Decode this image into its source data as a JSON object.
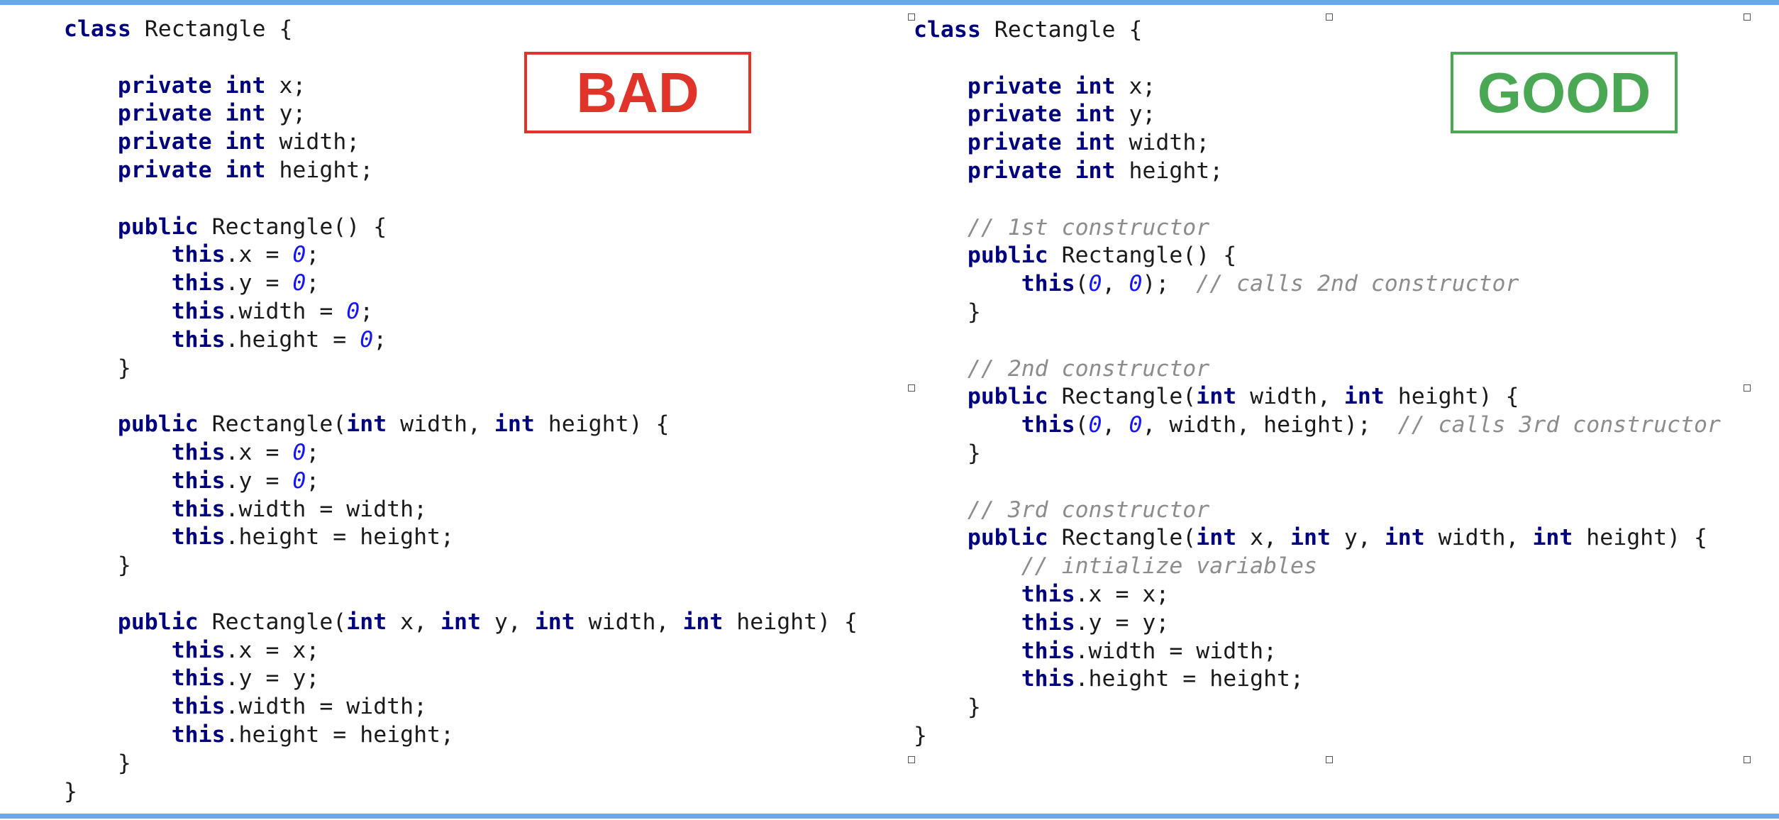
{
  "colors": {
    "bar": "#6aa6ec",
    "keyword": "#00007f",
    "number": "#1414ff",
    "comment": "#8c8c8c",
    "text": "#1a1a1a",
    "bad": "#e0332a",
    "good": "#4aa855"
  },
  "left_panel": {
    "label": "BAD",
    "label_color": "#e0332a",
    "lines": [
      [
        {
          "t": "kw",
          "v": "class"
        },
        {
          "t": "plain",
          "v": " Rectangle {"
        }
      ],
      [],
      [
        {
          "t": "plain",
          "v": "    "
        },
        {
          "t": "kw",
          "v": "private"
        },
        {
          "t": "plain",
          "v": " "
        },
        {
          "t": "kw",
          "v": "int"
        },
        {
          "t": "plain",
          "v": " x;"
        }
      ],
      [
        {
          "t": "plain",
          "v": "    "
        },
        {
          "t": "kw",
          "v": "private"
        },
        {
          "t": "plain",
          "v": " "
        },
        {
          "t": "kw",
          "v": "int"
        },
        {
          "t": "plain",
          "v": " y;"
        }
      ],
      [
        {
          "t": "plain",
          "v": "    "
        },
        {
          "t": "kw",
          "v": "private"
        },
        {
          "t": "plain",
          "v": " "
        },
        {
          "t": "kw",
          "v": "int"
        },
        {
          "t": "plain",
          "v": " width;"
        }
      ],
      [
        {
          "t": "plain",
          "v": "    "
        },
        {
          "t": "kw",
          "v": "private"
        },
        {
          "t": "plain",
          "v": " "
        },
        {
          "t": "kw",
          "v": "int"
        },
        {
          "t": "plain",
          "v": " height;"
        }
      ],
      [],
      [
        {
          "t": "plain",
          "v": "    "
        },
        {
          "t": "kw",
          "v": "public"
        },
        {
          "t": "plain",
          "v": " Rectangle() {"
        }
      ],
      [
        {
          "t": "plain",
          "v": "        "
        },
        {
          "t": "kw",
          "v": "this"
        },
        {
          "t": "plain",
          "v": ".x = "
        },
        {
          "t": "num",
          "v": "0"
        },
        {
          "t": "plain",
          "v": ";"
        }
      ],
      [
        {
          "t": "plain",
          "v": "        "
        },
        {
          "t": "kw",
          "v": "this"
        },
        {
          "t": "plain",
          "v": ".y = "
        },
        {
          "t": "num",
          "v": "0"
        },
        {
          "t": "plain",
          "v": ";"
        }
      ],
      [
        {
          "t": "plain",
          "v": "        "
        },
        {
          "t": "kw",
          "v": "this"
        },
        {
          "t": "plain",
          "v": ".width = "
        },
        {
          "t": "num",
          "v": "0"
        },
        {
          "t": "plain",
          "v": ";"
        }
      ],
      [
        {
          "t": "plain",
          "v": "        "
        },
        {
          "t": "kw",
          "v": "this"
        },
        {
          "t": "plain",
          "v": ".height = "
        },
        {
          "t": "num",
          "v": "0"
        },
        {
          "t": "plain",
          "v": ";"
        }
      ],
      [
        {
          "t": "plain",
          "v": "    }"
        }
      ],
      [],
      [
        {
          "t": "plain",
          "v": "    "
        },
        {
          "t": "kw",
          "v": "public"
        },
        {
          "t": "plain",
          "v": " Rectangle("
        },
        {
          "t": "kw",
          "v": "int"
        },
        {
          "t": "plain",
          "v": " width, "
        },
        {
          "t": "kw",
          "v": "int"
        },
        {
          "t": "plain",
          "v": " height) {"
        }
      ],
      [
        {
          "t": "plain",
          "v": "        "
        },
        {
          "t": "kw",
          "v": "this"
        },
        {
          "t": "plain",
          "v": ".x = "
        },
        {
          "t": "num",
          "v": "0"
        },
        {
          "t": "plain",
          "v": ";"
        }
      ],
      [
        {
          "t": "plain",
          "v": "        "
        },
        {
          "t": "kw",
          "v": "this"
        },
        {
          "t": "plain",
          "v": ".y = "
        },
        {
          "t": "num",
          "v": "0"
        },
        {
          "t": "plain",
          "v": ";"
        }
      ],
      [
        {
          "t": "plain",
          "v": "        "
        },
        {
          "t": "kw",
          "v": "this"
        },
        {
          "t": "plain",
          "v": ".width = width;"
        }
      ],
      [
        {
          "t": "plain",
          "v": "        "
        },
        {
          "t": "kw",
          "v": "this"
        },
        {
          "t": "plain",
          "v": ".height = height;"
        }
      ],
      [
        {
          "t": "plain",
          "v": "    }"
        }
      ],
      [],
      [
        {
          "t": "plain",
          "v": "    "
        },
        {
          "t": "kw",
          "v": "public"
        },
        {
          "t": "plain",
          "v": " Rectangle("
        },
        {
          "t": "kw",
          "v": "int"
        },
        {
          "t": "plain",
          "v": " x, "
        },
        {
          "t": "kw",
          "v": "int"
        },
        {
          "t": "plain",
          "v": " y, "
        },
        {
          "t": "kw",
          "v": "int"
        },
        {
          "t": "plain",
          "v": " width, "
        },
        {
          "t": "kw",
          "v": "int"
        },
        {
          "t": "plain",
          "v": " height) {"
        }
      ],
      [
        {
          "t": "plain",
          "v": "        "
        },
        {
          "t": "kw",
          "v": "this"
        },
        {
          "t": "plain",
          "v": ".x = x;"
        }
      ],
      [
        {
          "t": "plain",
          "v": "        "
        },
        {
          "t": "kw",
          "v": "this"
        },
        {
          "t": "plain",
          "v": ".y = y;"
        }
      ],
      [
        {
          "t": "plain",
          "v": "        "
        },
        {
          "t": "kw",
          "v": "this"
        },
        {
          "t": "plain",
          "v": ".width = width;"
        }
      ],
      [
        {
          "t": "plain",
          "v": "        "
        },
        {
          "t": "kw",
          "v": "this"
        },
        {
          "t": "plain",
          "v": ".height = height;"
        }
      ],
      [
        {
          "t": "plain",
          "v": "    }"
        }
      ],
      [
        {
          "t": "plain",
          "v": "}"
        }
      ]
    ]
  },
  "right_panel": {
    "label": "GOOD",
    "label_color": "#4aa855",
    "lines": [
      [
        {
          "t": "kw",
          "v": "class"
        },
        {
          "t": "plain",
          "v": " Rectangle {"
        }
      ],
      [],
      [
        {
          "t": "plain",
          "v": "    "
        },
        {
          "t": "kw",
          "v": "private"
        },
        {
          "t": "plain",
          "v": " "
        },
        {
          "t": "kw",
          "v": "int"
        },
        {
          "t": "plain",
          "v": " x;"
        }
      ],
      [
        {
          "t": "plain",
          "v": "    "
        },
        {
          "t": "kw",
          "v": "private"
        },
        {
          "t": "plain",
          "v": " "
        },
        {
          "t": "kw",
          "v": "int"
        },
        {
          "t": "plain",
          "v": " y;"
        }
      ],
      [
        {
          "t": "plain",
          "v": "    "
        },
        {
          "t": "kw",
          "v": "private"
        },
        {
          "t": "plain",
          "v": " "
        },
        {
          "t": "kw",
          "v": "int"
        },
        {
          "t": "plain",
          "v": " width;"
        }
      ],
      [
        {
          "t": "plain",
          "v": "    "
        },
        {
          "t": "kw",
          "v": "private"
        },
        {
          "t": "plain",
          "v": " "
        },
        {
          "t": "kw",
          "v": "int"
        },
        {
          "t": "plain",
          "v": " height;"
        }
      ],
      [],
      [
        {
          "t": "plain",
          "v": "    "
        },
        {
          "t": "com",
          "v": "// 1st constructor"
        }
      ],
      [
        {
          "t": "plain",
          "v": "    "
        },
        {
          "t": "kw",
          "v": "public"
        },
        {
          "t": "plain",
          "v": " Rectangle() {"
        }
      ],
      [
        {
          "t": "plain",
          "v": "        "
        },
        {
          "t": "kw",
          "v": "this"
        },
        {
          "t": "plain",
          "v": "("
        },
        {
          "t": "num",
          "v": "0"
        },
        {
          "t": "plain",
          "v": ", "
        },
        {
          "t": "num",
          "v": "0"
        },
        {
          "t": "plain",
          "v": ");  "
        },
        {
          "t": "com",
          "v": "// calls 2nd constructor"
        }
      ],
      [
        {
          "t": "plain",
          "v": "    }"
        }
      ],
      [],
      [
        {
          "t": "plain",
          "v": "    "
        },
        {
          "t": "com",
          "v": "// 2nd constructor"
        }
      ],
      [
        {
          "t": "plain",
          "v": "    "
        },
        {
          "t": "kw",
          "v": "public"
        },
        {
          "t": "plain",
          "v": " Rectangle("
        },
        {
          "t": "kw",
          "v": "int"
        },
        {
          "t": "plain",
          "v": " width, "
        },
        {
          "t": "kw",
          "v": "int"
        },
        {
          "t": "plain",
          "v": " height) {"
        }
      ],
      [
        {
          "t": "plain",
          "v": "        "
        },
        {
          "t": "kw",
          "v": "this"
        },
        {
          "t": "plain",
          "v": "("
        },
        {
          "t": "num",
          "v": "0"
        },
        {
          "t": "plain",
          "v": ", "
        },
        {
          "t": "num",
          "v": "0"
        },
        {
          "t": "plain",
          "v": ", width, height);  "
        },
        {
          "t": "com",
          "v": "// calls 3rd constructor"
        }
      ],
      [
        {
          "t": "plain",
          "v": "    }"
        }
      ],
      [],
      [
        {
          "t": "plain",
          "v": "    "
        },
        {
          "t": "com",
          "v": "// 3rd constructor"
        }
      ],
      [
        {
          "t": "plain",
          "v": "    "
        },
        {
          "t": "kw",
          "v": "public"
        },
        {
          "t": "plain",
          "v": " Rectangle("
        },
        {
          "t": "kw",
          "v": "int"
        },
        {
          "t": "plain",
          "v": " x, "
        },
        {
          "t": "kw",
          "v": "int"
        },
        {
          "t": "plain",
          "v": " y, "
        },
        {
          "t": "kw",
          "v": "int"
        },
        {
          "t": "plain",
          "v": " width, "
        },
        {
          "t": "kw",
          "v": "int"
        },
        {
          "t": "plain",
          "v": " height) {"
        }
      ],
      [
        {
          "t": "plain",
          "v": "        "
        },
        {
          "t": "com",
          "v": "// intialize variables"
        }
      ],
      [
        {
          "t": "plain",
          "v": "        "
        },
        {
          "t": "kw",
          "v": "this"
        },
        {
          "t": "plain",
          "v": ".x = x;"
        }
      ],
      [
        {
          "t": "plain",
          "v": "        "
        },
        {
          "t": "kw",
          "v": "this"
        },
        {
          "t": "plain",
          "v": ".y = y;"
        }
      ],
      [
        {
          "t": "plain",
          "v": "        "
        },
        {
          "t": "kw",
          "v": "this"
        },
        {
          "t": "plain",
          "v": ".width = width;"
        }
      ],
      [
        {
          "t": "plain",
          "v": "        "
        },
        {
          "t": "kw",
          "v": "this"
        },
        {
          "t": "plain",
          "v": ".height = height;"
        }
      ],
      [
        {
          "t": "plain",
          "v": "    }"
        }
      ],
      [
        {
          "t": "plain",
          "v": "}"
        }
      ]
    ]
  }
}
